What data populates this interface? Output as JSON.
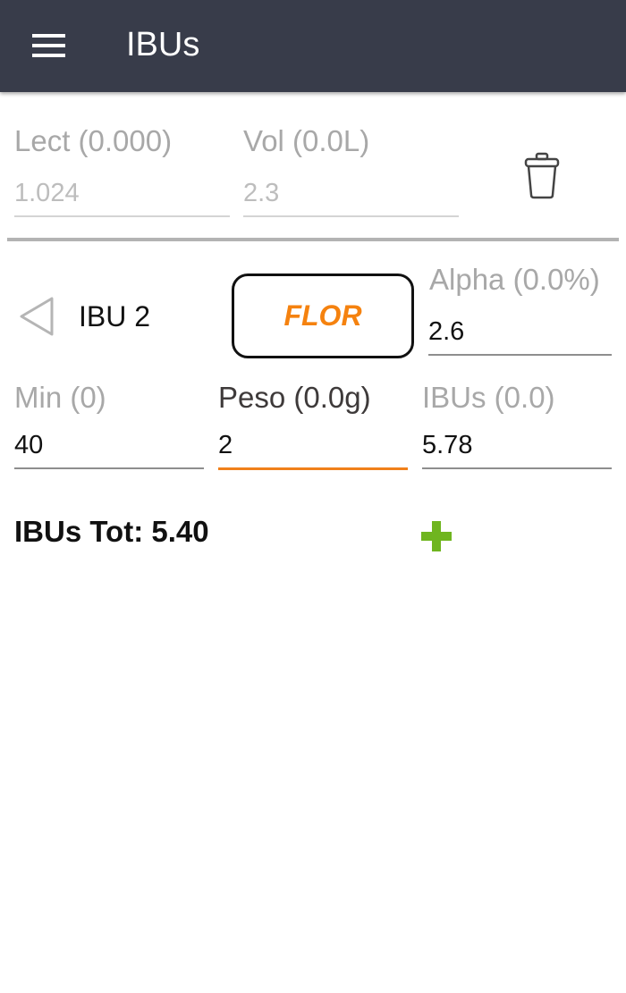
{
  "app_bar": {
    "title": "IBUs",
    "menu_icon": "hamburger-menu-icon"
  },
  "reading": {
    "lect_label": "Lect (0.000)",
    "lect_value": "1.024",
    "vol_label": "Vol (0.0L)",
    "vol_value": "2.3",
    "delete_icon": "trash-icon"
  },
  "hop": {
    "nav_icon": "triangle-left-icon",
    "name": "IBU 2",
    "type_button": "FLOR",
    "alpha_label": "Alpha (0.0%)",
    "alpha_value": "2.6",
    "min_label": "Min (0)",
    "min_value": "40",
    "peso_label": "Peso (0.0g)",
    "peso_value": "2",
    "ibus_label": "IBUs (0.0)",
    "ibus_value": "5.78"
  },
  "summary": {
    "total": "IBUs Tot: 5.40",
    "add_icon": "plus-icon"
  },
  "colors": {
    "appbar": "#383c4a",
    "accent": "#f5820f",
    "add": "#6fb51f"
  }
}
